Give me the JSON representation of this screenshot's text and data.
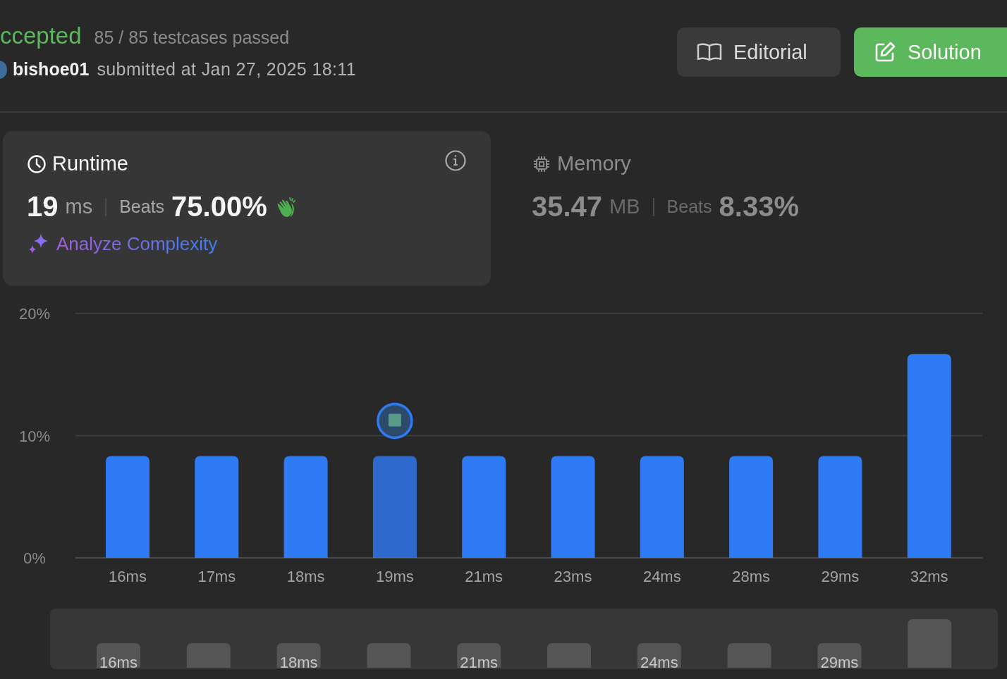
{
  "status": {
    "label": "ccepted",
    "testcases": "85 / 85 testcases passed"
  },
  "submission": {
    "user": "bishoe01",
    "submitted": "submitted at Jan 27, 2025 18:11"
  },
  "buttons": [
    {
      "kind": "editorial",
      "label": "Editorial"
    },
    {
      "kind": "solution",
      "label": "Solution"
    }
  ],
  "runtime": {
    "title": "Runtime",
    "value": "19",
    "unit": "ms",
    "beats_label": "Beats",
    "beats": "75.00%",
    "analyze": "Analyze Complexity",
    "selected": true
  },
  "memory": {
    "title": "Memory",
    "value": "35.47",
    "unit": "MB",
    "beats_label": "Beats",
    "beats": "8.33%",
    "selected": false
  },
  "runtime_chart": {
    "bars": [
      {
        "selected": false
      },
      {
        "selected": false
      },
      {
        "selected": false
      },
      {
        "selected": true
      },
      {
        "selected": false
      },
      {
        "selected": false
      },
      {
        "selected": false
      },
      {
        "selected": false
      },
      {
        "selected": false
      },
      {
        "selected": false
      }
    ],
    "chart_data": {
      "type": "bar",
      "categories": [
        "16ms",
        "17ms",
        "18ms",
        "19ms",
        "21ms",
        "23ms",
        "24ms",
        "28ms",
        "29ms",
        "32ms"
      ],
      "series": [
        {
          "color": "#2f7bf6",
          "values": [
            8.33,
            8.33,
            8.33,
            8.33,
            8.33,
            8.33,
            8.33,
            8.33,
            8.33,
            16.67
          ]
        }
      ],
      "ylim": [
        0,
        20
      ],
      "yticks": [
        {
          "value": 0,
          "label": "0%"
        },
        {
          "value": 10,
          "label": "10%"
        },
        {
          "value": 20,
          "label": "20%"
        }
      ]
    }
  },
  "overview_labels": [
    "16ms",
    "18ms",
    "21ms",
    "24ms",
    "29ms"
  ]
}
